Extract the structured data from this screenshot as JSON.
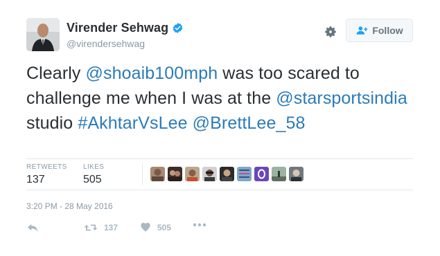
{
  "author": {
    "name": "Virender Sehwag",
    "handle": "@virendersehwag",
    "verified": true
  },
  "follow_button": {
    "label": "Follow",
    "icon": "add-user-icon"
  },
  "settings": {
    "icon": "gear-icon"
  },
  "tweet": {
    "segments": [
      {
        "text": "Clearly ",
        "link": false
      },
      {
        "text": "@shoaib100mph",
        "link": true
      },
      {
        "text": " was too scared to challenge me when I was at the ",
        "link": false
      },
      {
        "text": "@starsportsindia",
        "link": true
      },
      {
        "text": " studio ",
        "link": false
      },
      {
        "text": "#AkhtarVsLee",
        "link": true
      },
      {
        "text": " ",
        "link": false
      },
      {
        "text": "@BrettLee_58",
        "link": true
      }
    ]
  },
  "stats": {
    "retweets_label": "RETWEETS",
    "retweets_value": "137",
    "likes_label": "LIKES",
    "likes_value": "505"
  },
  "likers_count": 9,
  "timestamp": "3:20 PM - 28 May 2016",
  "actions": {
    "reply_icon": "reply-icon",
    "retweet_icon": "retweet-icon",
    "retweet_count": "137",
    "like_icon": "heart-icon",
    "like_count": "505",
    "more_icon": "more-icon"
  },
  "colors": {
    "link": "#2b7bb9",
    "text": "#292f33",
    "muted": "#8899a6",
    "verified": "#1da1f2",
    "action": "#aab8c2"
  }
}
